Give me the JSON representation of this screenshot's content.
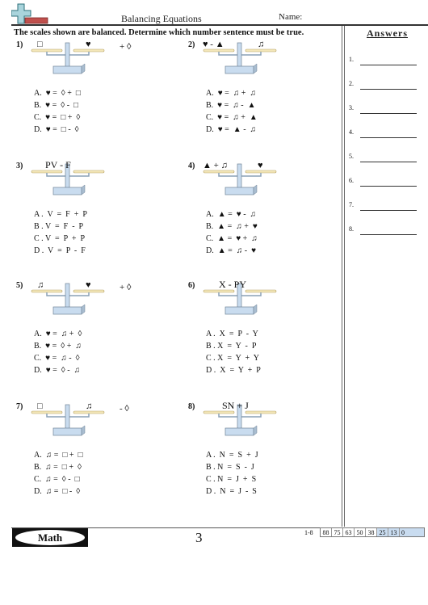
{
  "header": {
    "title": "Balancing Equations",
    "name_label": "Name:",
    "instructions": "The scales shown are balanced. Determine which number sentence must be true."
  },
  "answers": {
    "title": "Answers",
    "items": [
      "1.",
      "2.",
      "3.",
      "4.",
      "5.",
      "6.",
      "7.",
      "8."
    ]
  },
  "problems": [
    {
      "number": "1)",
      "left_pan": "□",
      "right_pan": "♥",
      "extra": "+ ◊",
      "choices": [
        "A.  ♥ =  ◊ +  □",
        "B.  ♥ =  ◊ -  □",
        "C.  ♥ =  □ +  ◊",
        "D.  ♥ =  □ -  ◊"
      ]
    },
    {
      "number": "2)",
      "left_pan": "♥ - ▲",
      "right_pan": "♫",
      "extra": "",
      "choices": [
        "A.  ♥ =  ♫ +  ♫",
        "B.  ♥ =  ♫ -  ▲",
        "C.  ♥ =  ♫ +  ▲",
        "D.  ♥ =  ▲ -  ♫"
      ]
    },
    {
      "number": "3)",
      "left_pan": "PV - F",
      "right_pan": "",
      "extra": "",
      "choices": [
        "A .  V  =  F  +  P",
        "B . V  =  F  -  P",
        "C . V  =  P  +  P",
        "D .  V  =  P  -  F"
      ]
    },
    {
      "number": "4)",
      "left_pan": "▲ + ♫",
      "right_pan": "♥",
      "extra": "",
      "choices": [
        "A.  ▲ =  ♥ -  ♫",
        "B.  ▲ =  ♫ +  ♥",
        "C.  ▲ =  ♥ +  ♫",
        "D.  ▲ =  ♫ -  ♥"
      ]
    },
    {
      "number": "5)",
      "left_pan": "♫",
      "right_pan": "♥",
      "extra": "+ ◊",
      "choices": [
        "A.  ♥ =  ♫ +  ◊",
        "B.  ♥ =  ◊ +  ♫",
        "C.  ♥ =  ♫ -  ◊",
        "D.  ♥ =  ◊ -  ♫"
      ]
    },
    {
      "number": "6)",
      "left_pan": "X - PY",
      "right_pan": "",
      "extra": "",
      "choices": [
        "A .  X  =  P  -  Y",
        "B . X  =  Y  -  P",
        "C . X  =  Y  +  Y",
        "D .  X  =  Y  +  P"
      ]
    },
    {
      "number": "7)",
      "left_pan": "□",
      "right_pan": "♫",
      "extra": "- ◊",
      "choices": [
        "A.  ♫ =  □ +  □",
        "B.  ♫ =  □ +  ◊",
        "C.  ♫ =  ◊ -  □",
        "D.  ♫ =  □ -  ◊"
      ]
    },
    {
      "number": "8)",
      "left_pan": "SN + J",
      "right_pan": "",
      "extra": "",
      "choices": [
        "A .  N  =  S  +  J",
        "B . N  =  S  -  J",
        "C . N  =  J  +  S",
        "D .  N  =  J  -  S"
      ]
    }
  ],
  "footer": {
    "subject": "Math",
    "page_number": "3",
    "score_label": "1-8",
    "scores": [
      "88",
      "75",
      "63",
      "50",
      "38",
      "25",
      "13",
      "0"
    ]
  },
  "colors": {
    "scale_pan": "#f3e6b8",
    "scale_metal": "#c9dcef",
    "logo_plus": "#a9d4dc",
    "logo_minus": "#c0504d",
    "score_highlight": "#c9dcf0"
  }
}
